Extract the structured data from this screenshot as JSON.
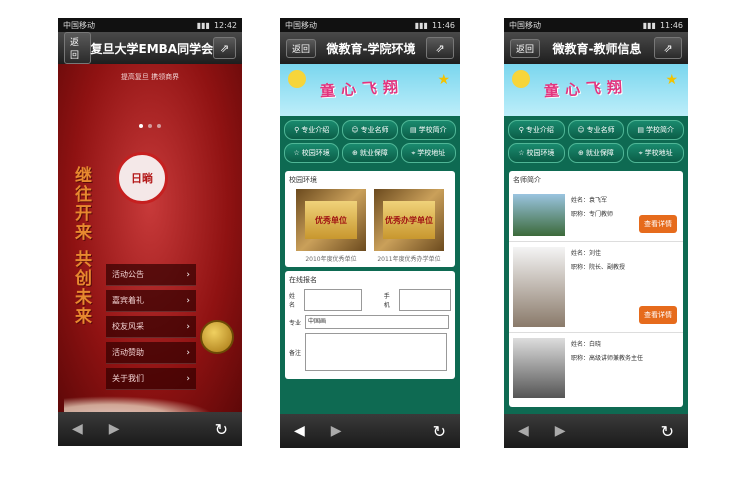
{
  "phone1": {
    "carrier": "中国移动",
    "time": "12:42",
    "back_label": "返回",
    "title": "复旦大学EMBA同学会",
    "subtitle": "提高复旦 携领商界",
    "calligraphy": "继往开来 共创未来",
    "logo_text": "日㫾",
    "menu": [
      "活动公告",
      "嘉宾着礼",
      "校友风采",
      "活动赞助",
      "关于我们"
    ]
  },
  "phone2": {
    "carrier": "中国移动",
    "time": "11:46",
    "back_label": "返回",
    "title": "微教育-学院环境",
    "banner_text": "童心飞翔",
    "nav": [
      "专业介绍",
      "专业名师",
      "学校简介",
      "校园环境",
      "就业保障",
      "学校地址"
    ],
    "env_title": "校园环境",
    "photos": [
      {
        "plaque": "优秀单位",
        "caption": "2010年度优秀单位"
      },
      {
        "plaque": "优秀办学单位",
        "caption": "2011年度优秀办学单位"
      }
    ],
    "form_title": "在线报名",
    "form": {
      "name_label": "姓名",
      "phone_label": "手机",
      "major_label": "专业",
      "major_value": "中国画",
      "note_label": "备注"
    }
  },
  "phone3": {
    "carrier": "中国移动",
    "time": "11:46",
    "back_label": "返回",
    "title": "微教育-教师信息",
    "banner_text": "童心飞翔",
    "nav": [
      "专业介绍",
      "专业名师",
      "学校简介",
      "校园环境",
      "就业保障",
      "学校地址"
    ],
    "section_title": "名师简介",
    "teachers": [
      {
        "name": "姓名：袁飞军",
        "title": "职称：专门教师",
        "button": "查看详情"
      },
      {
        "name": "姓名：刘佳",
        "title": "职称：院长、副教授",
        "button": "查看详情"
      },
      {
        "name": "姓名：白晓",
        "title": "职称：高级讲师兼教务主任",
        "button": ""
      }
    ]
  },
  "icons": {
    "back": "back-arrow-icon",
    "forward": "forward-arrow-icon",
    "refresh": "refresh-icon",
    "share": "share-icon"
  }
}
